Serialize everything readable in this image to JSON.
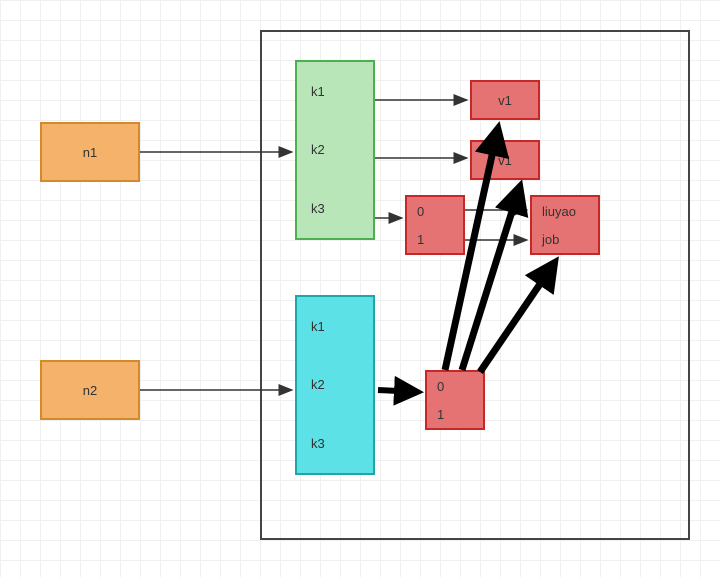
{
  "nodes": {
    "n1": "n1",
    "n2": "n2"
  },
  "container": {
    "green": {
      "k1": "k1",
      "k2": "k2",
      "k3": "k3"
    },
    "cyan": {
      "k1": "k1",
      "k2": "k2",
      "k3": "k3"
    },
    "red_v1a": "v1",
    "red_v1b": "v1",
    "red_small_top": {
      "a": "0",
      "b": "1"
    },
    "red_liuyao": {
      "a": "liuyao",
      "b": "job"
    },
    "red_small_bottom": {
      "a": "0",
      "b": "1"
    }
  }
}
